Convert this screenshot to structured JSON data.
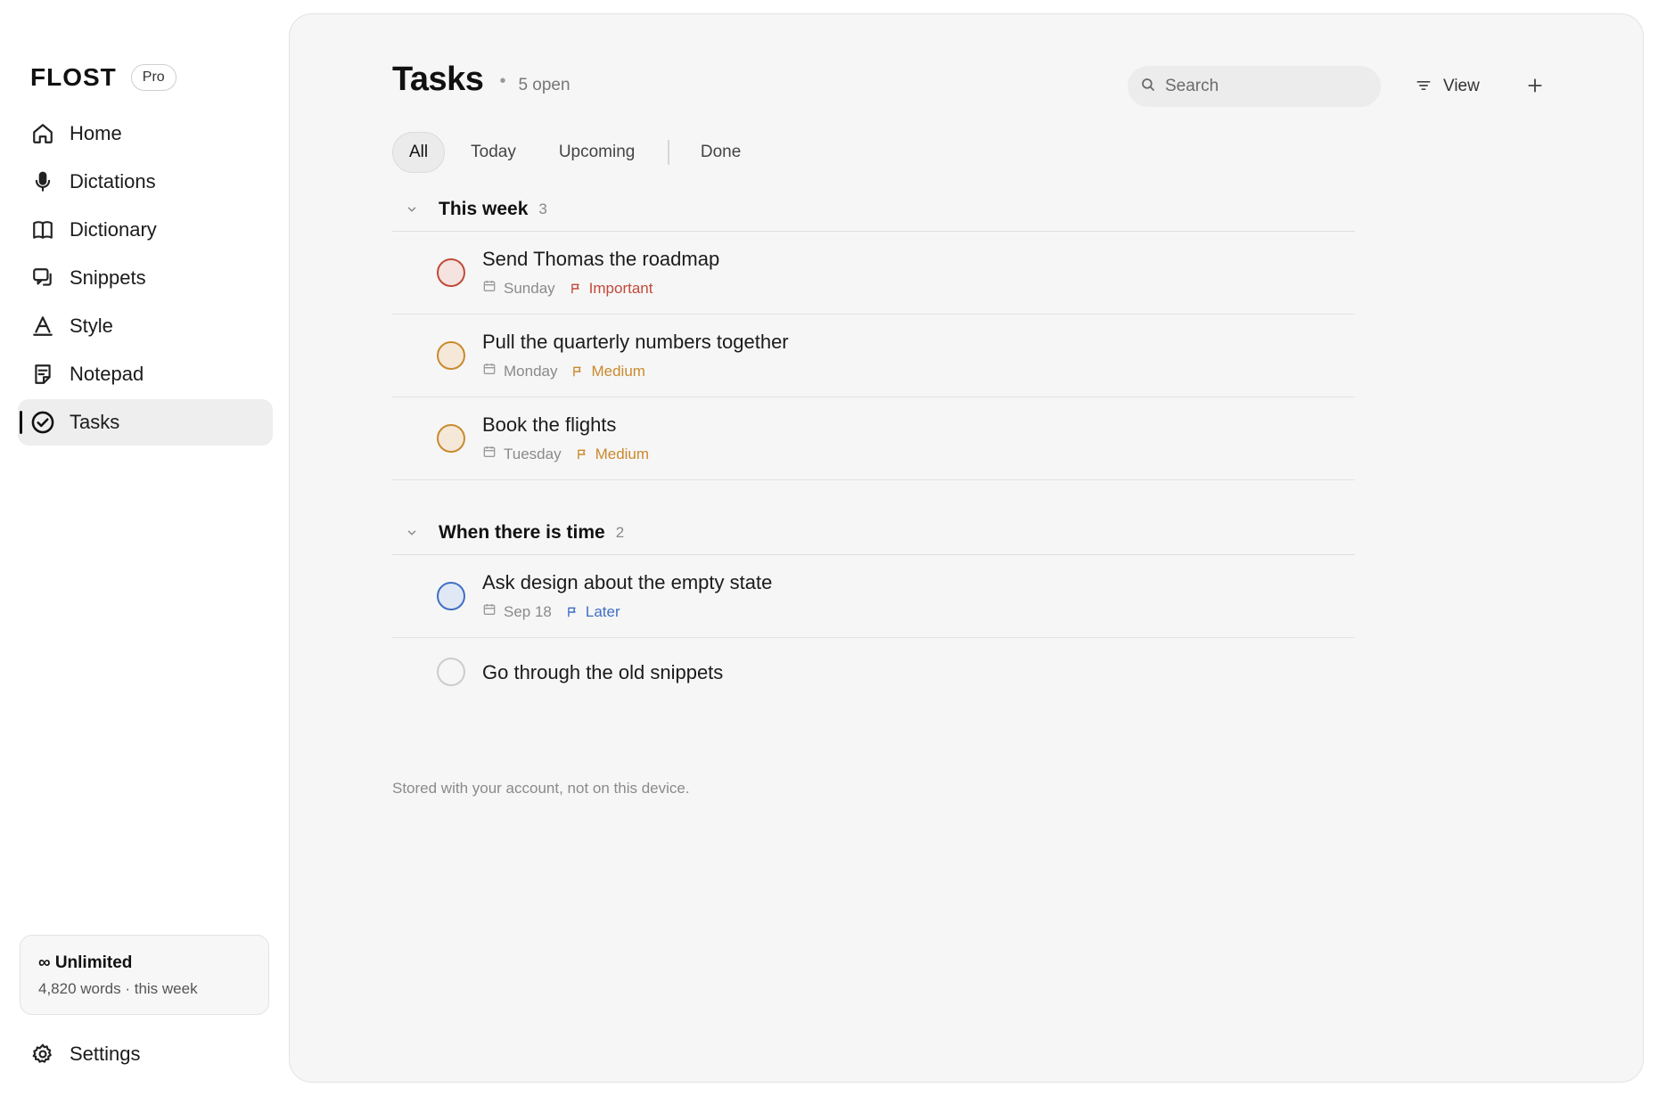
{
  "brand": {
    "logo": "FLOST",
    "plan_badge": "Pro"
  },
  "nav": {
    "items": [
      {
        "label": "Home",
        "icon": "home-icon"
      },
      {
        "label": "Dictations",
        "icon": "microphone-icon"
      },
      {
        "label": "Dictionary",
        "icon": "book-icon"
      },
      {
        "label": "Snippets",
        "icon": "snippets-icon"
      },
      {
        "label": "Style",
        "icon": "style-icon"
      },
      {
        "label": "Notepad",
        "icon": "notepad-icon"
      },
      {
        "label": "Tasks",
        "icon": "check-circle-icon",
        "active": true
      }
    ]
  },
  "usage": {
    "title": "∞ Unlimited",
    "subtitle": "4,820 words · this week"
  },
  "settings": {
    "label": "Settings",
    "icon": "gear-icon"
  },
  "header": {
    "title": "Tasks",
    "separator": "•",
    "open_count": "5 open"
  },
  "search": {
    "placeholder": "Search",
    "value": ""
  },
  "toolbar": {
    "view_label": "View",
    "add_icon": "plus-icon"
  },
  "tabs": [
    {
      "label": "All",
      "active": true
    },
    {
      "label": "Today"
    },
    {
      "label": "Upcoming"
    },
    {
      "label": "Done"
    }
  ],
  "sections": [
    {
      "title": "This week",
      "count": "3",
      "tasks": [
        {
          "title": "Send Thomas the roadmap",
          "date": "Sunday",
          "priority": "Important"
        },
        {
          "title": "Pull the quarterly numbers together",
          "date": "Monday",
          "priority": "Medium"
        },
        {
          "title": "Book the flights",
          "date": "Tuesday",
          "priority": "Medium"
        }
      ]
    },
    {
      "title": "When there is time",
      "count": "2",
      "tasks": [
        {
          "title": "Ask design about the empty state",
          "date": "Sep 18",
          "priority": "Later"
        },
        {
          "title": "Go through the old snippets"
        }
      ]
    }
  ],
  "footnote": "Stored with your account, not on this device.",
  "colors": {
    "important": "#c24a3a",
    "important_fill": "#f5e3e0",
    "medium": "#c98a2e",
    "medium_fill": "#f5e8d9",
    "later": "#3f6fc4",
    "later_fill": "#e1e8f5",
    "none": "#cccccc"
  }
}
